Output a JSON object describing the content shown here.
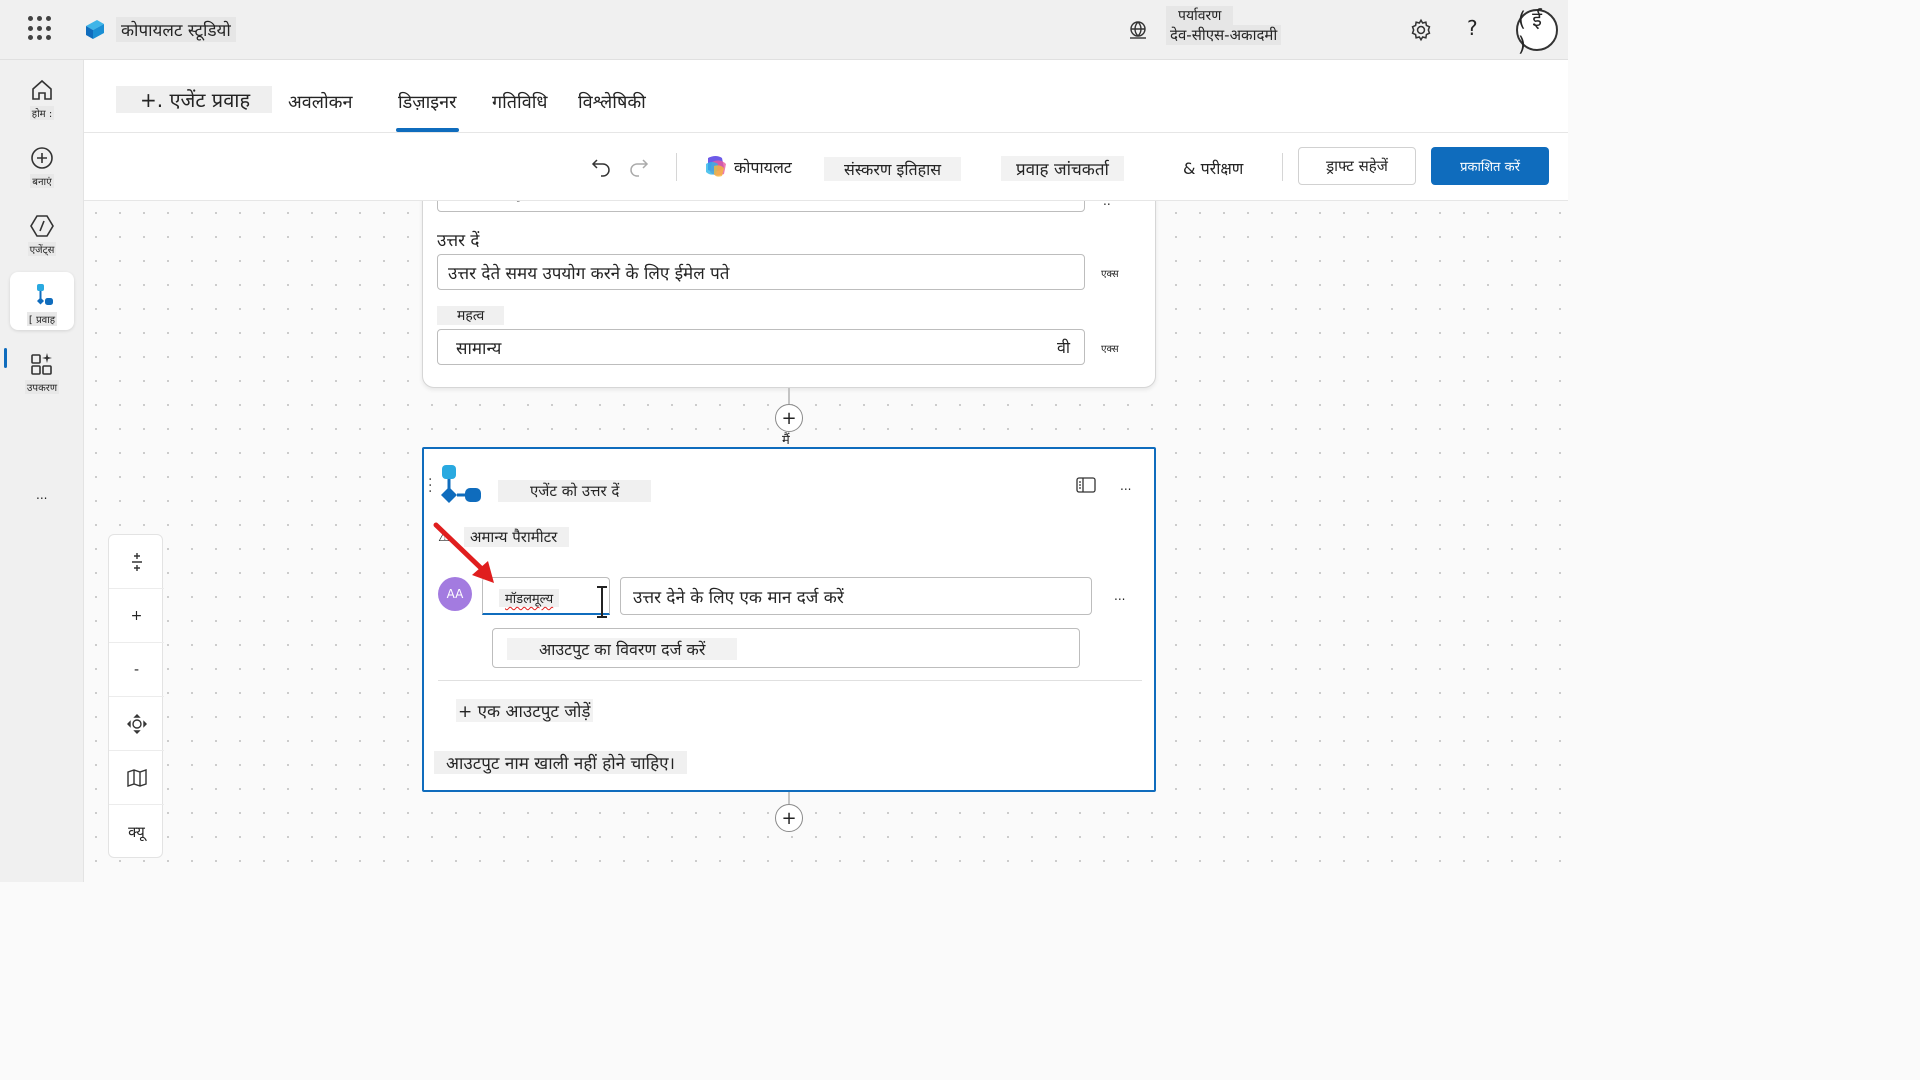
{
  "header": {
    "app_title": "कोपायलट स्टूडियो",
    "environment_label": "पर्यावरण",
    "environment_name": "देव-सीएस-अकादमी",
    "help_label": "?",
    "user_initial": "( ई )"
  },
  "leftnav": {
    "items": [
      {
        "label": "होम :"
      },
      {
        "label": "बनाएं"
      },
      {
        "label": "एजेंट्स"
      },
      {
        "label": "[ प्रवाह"
      },
      {
        "label": "उपकरण"
      }
    ],
    "more": "..."
  },
  "tabs": {
    "flow_name": "+. एजेंट प्रवाह",
    "items": [
      {
        "label": "अवलोकन"
      },
      {
        "label": "डिज़ाइनर"
      },
      {
        "label": "गतिविधि"
      },
      {
        "label": "विश्लेषिकी"
      }
    ]
  },
  "toolbar": {
    "copilot": "कोपायलट",
    "version_history": "संस्करण इतिहास",
    "flow_checker": "प्रवाह जांचकर्ता",
    "test": "& परीक्षण",
    "save_draft": "ड्राफ्ट सहेजें",
    "publish": "प्रकाशित करें"
  },
  "card1": {
    "top_field_placeholder": "Sensitivity",
    "top_more": "..",
    "reply_to_label": "उत्तर दें",
    "reply_to_value": "उत्तर देते समय उपयोग करने के लिए ईमेल पते",
    "fx_label": "एक्स",
    "importance_label": "महत्व",
    "importance_value": "सामान्य",
    "importance_chevron": "वी"
  },
  "connector": {
    "plus": "+",
    "below_label": "मैं"
  },
  "card2": {
    "title": "एजेंट को उत्तर दें",
    "more": "...",
    "warning": "अमान्य पैरामीटर",
    "output_avatar": "AA",
    "output_name": "मॉडलमूल्य",
    "output_value_placeholder": "उत्तर देने के लिए एक मान दर्ज करें",
    "output_description_placeholder": "आउटपुट का विवरण दर्ज करें",
    "add_output": "+ एक आउटपुट जोड़ें",
    "error": "आउटपुट नाम खाली नहीं होने चाहिए।"
  },
  "zoom": {
    "zoom_in": "+",
    "zoom_out": "-",
    "q_label": "क्यू"
  },
  "colors": {
    "accent": "#0f6cbd",
    "error_arrow": "#e01e1e",
    "avatar": "#a37be0"
  }
}
